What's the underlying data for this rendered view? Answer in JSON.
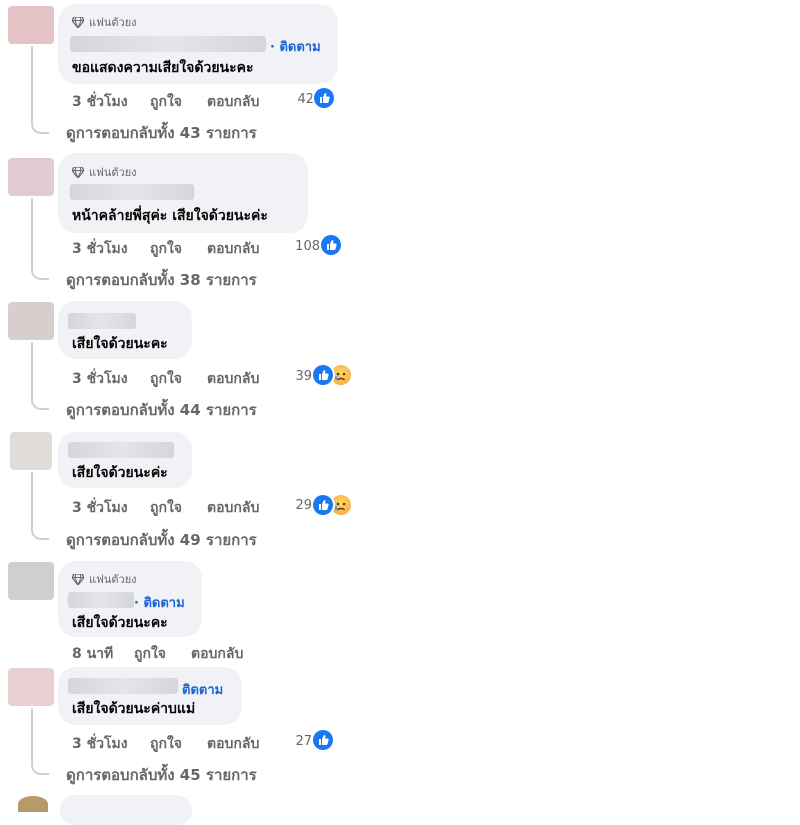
{
  "ui": {
    "top_fan_badge": "แฟนตัวยง",
    "follow_label": "ติดตาม",
    "like_label": "ถูกใจ",
    "reply_label": "ตอบกลับ"
  },
  "comments": [
    {
      "time": "3 ชั่วโมง",
      "text": "ขอแสดงความเสียใจด้วยนะคะ",
      "reactions": "42",
      "replies": "ดูการตอบกลับทั้ง 43 รายการ",
      "avatar_color": "#e4c3c6"
    },
    {
      "time": "3 ชั่วโมง",
      "text": "หน้าคล้ายพี่สุค่ะ เสียใจด้วยนะค่ะ",
      "reactions": "108",
      "replies": "ดูการตอบกลับทั้ง 38 รายการ",
      "avatar_color": "#e2ccd1"
    },
    {
      "time": "3 ชั่วโมง",
      "text": "เสียใจด้วยนะคะ",
      "reactions": "39",
      "replies": "ดูการตอบกลับทั้ง 44 รายการ",
      "avatar_color": "#d6cfcd"
    },
    {
      "time": "3 ชั่วโมง",
      "text": "เสียใจด้วยนะค่ะ",
      "reactions": "29",
      "replies": "ดูการตอบกลับทั้ง 49 รายการ",
      "avatar_color": "#e2dcd8"
    },
    {
      "time": "8 นาที",
      "text": "เสียใจด้วยนะคะ",
      "avatar_color": "#cfcfcf"
    },
    {
      "time": "3 ชั่วโมง",
      "text": "เสียใจด้วยนะค่าบแม่",
      "reactions": "27",
      "replies": "ดูการตอบกลับทั้ง 45 รายการ",
      "avatar_color": "#e8cfd2"
    }
  ]
}
